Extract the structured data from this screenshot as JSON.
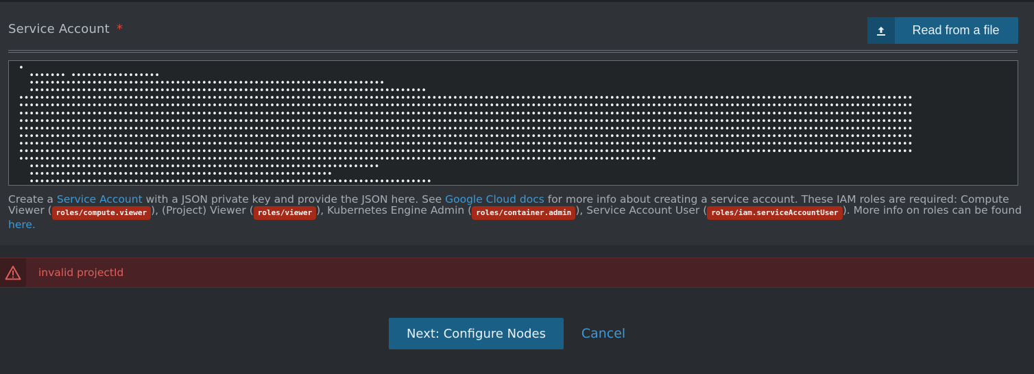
{
  "service_account": {
    "label": "Service Account",
    "required_marker": "*",
    "read_button_label": "Read from a file",
    "upload_icon": "upload-icon",
    "masked_value": "•\n  ••••••• •••••••••••••••••\n  ••••••••••••••••••••••••••••••••••••••••••••••••••••••••••••••••••••\n  ••••••••••••••••••••••••••••••••••••••••••••••••••••••••••••••••••••••••••••\n•••••••••••••••••••••••••••••••••••••••••••••••••••••••••••••••••••••••••••••••••••••••••••••••••••••••••••••••••••••••••••••••••••••••••••••••••••••••••••••••••••••••••••\n•••••••••••••••••••••••••••••••••••••••••••••••••••••••••••••••••••••••••••••••••••••••••••••••••••••••••••••••••••••••••••••••••••••••••••••••••••••••••••••••••••••••••••\n•••••••••••••••••••••••••••••••••••••••••••••••••••••••••••••••••••••••••••••••••••••••••••••••••••••••••••••••••••••••••••••••••••••••••••••••••••••••••••••••••••••••••••\n•••••••••••••••••••••••••••••••••••••••••••••••••••••••••••••••••••••••••••••••••••••••••••••••••••••••••••••••••••••••••••••••••••••••••••••••••••••••••••••••••••••••••••\n•••••••••••••••••••••••••••••••••••••••••••••••••••••••••••••••••••••••••••••••••••••••••••••••••••••••••••••••••••••••••••••••••••••••••••••••••••••••••••••••••••••••••••\n•••••••••••••••••••••••••••••••••••••••••••••••••••••••••••••••••••••••••••••••••••••••••••••••••••••••••••••••••••••••••••••••••••••••••••••••••••••••••••••••••••••••••••\n•••••••••••••••••••••••••••••••••••••••••••••••••••••••••••••••••••••••••••••••••••••••••••••••••••••••••••••••••••••••••••••••••••••••••••••••••••••••••••••••••••••••••••\n•••••••••••••••••••••••••••••••••••••••••••••••••••••••••••••••••••••••••••••••••••••••••••••••••••••••••••••••••••••••••••••••••••••••••••••••••••••••••••••••••••••••••••\n••••••••••••••••••••••••••••••••••••••••••••••••••••••••••••••••••••••••••••••••••••••••••••••••••••••••••••••••••••••••••\n  •••••••••••••••••••••••••••••••••••••••••••••••••••••••••••••••••••\n  ••••••••••••••••••••••••••••••••••••••••••••••••••••••••••\n  •••••••••••••••••••••••••••••••••••••••••••••••••••••••••••••••••••••••••••••\n  •••••••••••••••••••••••••••••••••••••••••••••••••••••••••••••••••••••••••••••••••••••••••••••••••••••••••••••••••••\n•"
  },
  "help": {
    "t1": "Create a ",
    "link_service_account": "Service Account",
    "t2": " with a JSON private key and provide the JSON here. See ",
    "link_docs": "Google Cloud docs",
    "t3": " for more info about creating a service account. These IAM roles are required: Compute Viewer (",
    "role_compute_viewer": "roles/compute.viewer",
    "t4": "), (Project) Viewer (",
    "role_viewer": "roles/viewer",
    "t5": "), Kubernetes Engine Admin (",
    "role_container_admin": "roles/container.admin",
    "t6": "), Service Account User (",
    "role_sa_user": "roles/iam.serviceAccountUser",
    "t7": "). More info on roles can be found ",
    "link_here": "here."
  },
  "error": {
    "icon": "warning-icon",
    "message": "invalid projectId",
    "color": "#e35d59"
  },
  "actions": {
    "next_label": "Next: Configure Nodes",
    "cancel_label": "Cancel"
  },
  "colors": {
    "background": "#282c30",
    "panel": "#2f3337",
    "primary_button": "#1a5f86",
    "link": "#3b9ad9",
    "code_chip": "#a52a18"
  }
}
